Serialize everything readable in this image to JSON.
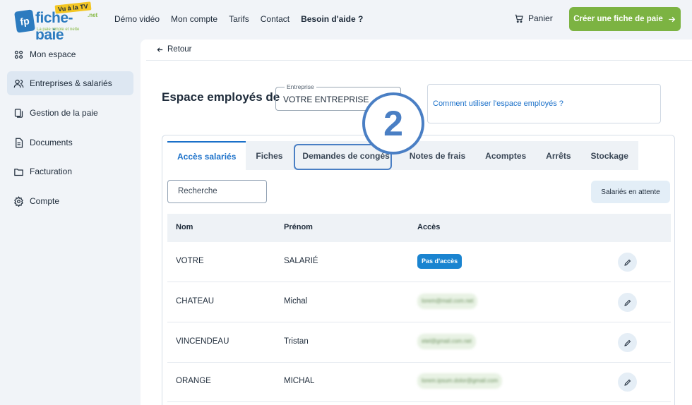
{
  "header": {
    "logo": {
      "brand": "fiche-paie",
      "badge": "Vu à la TV",
      "suffix": ".net",
      "tagline": "La paie simple et nette"
    },
    "nav": [
      "Démo vidéo",
      "Mon compte",
      "Tarifs",
      "Contact"
    ],
    "help": "Besoin d'aide ?",
    "cart": "Panier",
    "cta": "Créer une fiche de paie"
  },
  "sidebar": {
    "items": [
      {
        "label": "Mon espace",
        "icon": "grid-icon"
      },
      {
        "label": "Entreprises & salariés",
        "icon": "users-icon",
        "active": true
      },
      {
        "label": "Gestion de la paie",
        "icon": "documents-icon"
      },
      {
        "label": "Documents",
        "icon": "document-icon"
      },
      {
        "label": "Facturation",
        "icon": "folder-icon"
      },
      {
        "label": "Compte",
        "icon": "gear-icon"
      }
    ]
  },
  "main": {
    "back": "Retour",
    "title": "Espace employés de",
    "company_label": "Entreprise",
    "company_value": "VOTRE ENTREPRISE",
    "help_link": "Comment utiliser l'espace employés ?",
    "step_badge": "2",
    "tabs": [
      "Accès salariés",
      "Fiches",
      "Demandes de congés",
      "Notes de frais",
      "Acomptes",
      "Arrêts",
      "Stockage"
    ],
    "active_tab": "Accès salariés",
    "highlighted_tab": "Demandes de congés",
    "search_placeholder": "Recherche",
    "pending_button": "Salariés en attente",
    "table": {
      "headers": [
        "Nom",
        "Prénom",
        "Accès"
      ],
      "rows": [
        {
          "nom": "VOTRE",
          "prenom": "SALARIÉ",
          "acces": "Pas d'accès"
        },
        {
          "nom": "CHATEAU",
          "prenom": "Michal",
          "acces": "lorem@mail.com.net"
        },
        {
          "nom": "VINCENDEAU",
          "prenom": "Tristan",
          "acces": "etel@gmail.com.net"
        },
        {
          "nom": "ORANGE",
          "prenom": "MICHAL",
          "acces": "lorem.ipsum.dolor@gmail.com"
        }
      ]
    }
  },
  "colors": {
    "accent": "#1a70c9",
    "cta": "#7cb342",
    "badge": "#4a7fc4"
  }
}
